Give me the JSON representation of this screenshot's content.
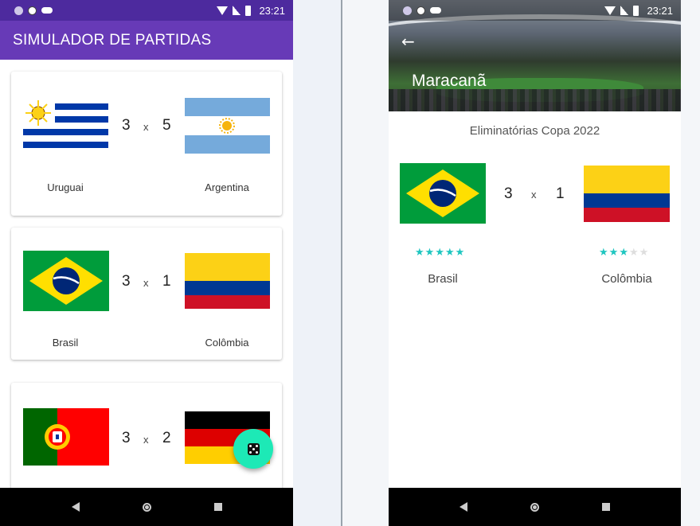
{
  "status_bar": {
    "time": "23:21"
  },
  "list_screen": {
    "app_bar_title": "SIMULADOR DE PARTIDAS",
    "matches": [
      {
        "home": {
          "name": "Uruguai",
          "flag": "uruguay-flag",
          "score": "3"
        },
        "separator": "x",
        "away": {
          "name": "Argentina",
          "flag": "argentina-flag",
          "score": "5"
        }
      },
      {
        "home": {
          "name": "Brasil",
          "flag": "brazil-flag",
          "score": "3"
        },
        "separator": "x",
        "away": {
          "name": "Colômbia",
          "flag": "colombia-flag",
          "score": "1"
        }
      },
      {
        "home": {
          "name": "",
          "flag": "portugal-flag",
          "score": "3"
        },
        "separator": "x",
        "away": {
          "name": "",
          "flag": "germany-flag",
          "score": "2"
        }
      }
    ],
    "fab_icon": "dice-icon"
  },
  "detail_screen": {
    "stadium": "Maracanã",
    "competition": "Eliminatórias Copa 2022",
    "home": {
      "name": "Brasil",
      "score": "3",
      "stars": 5
    },
    "separator": "x",
    "away": {
      "name": "Colômbia",
      "score": "1",
      "stars": 3
    },
    "max_stars": 5
  },
  "colors": {
    "primary": "#673ab7",
    "primary_dark": "#4d2a9e",
    "accent": "#1de9b6",
    "star": "#1ec6c0"
  }
}
